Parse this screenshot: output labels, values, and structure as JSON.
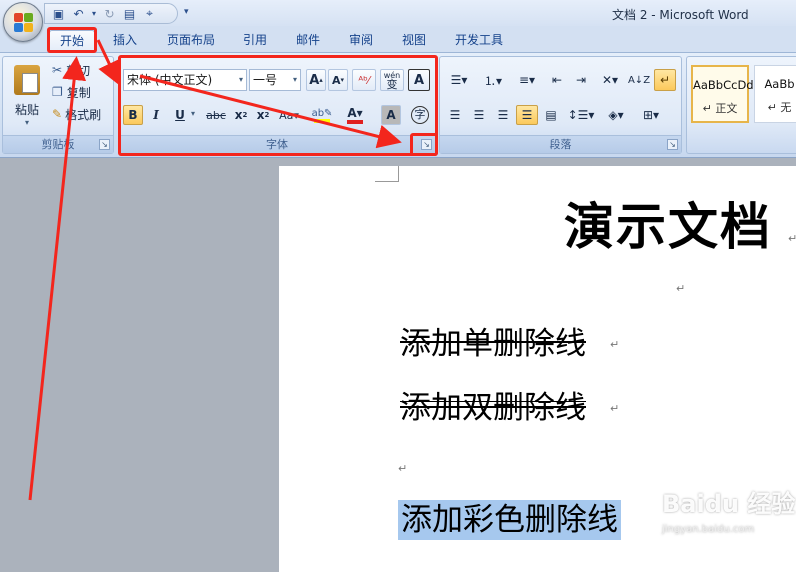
{
  "window": {
    "title": "文档 2 - Microsoft Word"
  },
  "quick_access": [
    "save-icon",
    "undo-icon",
    "redo-icon",
    "print-preview-icon",
    "customize-icon"
  ],
  "tabs": [
    {
      "label": "开始",
      "active": true
    },
    {
      "label": "插入"
    },
    {
      "label": "页面布局"
    },
    {
      "label": "引用"
    },
    {
      "label": "邮件"
    },
    {
      "label": "审阅"
    },
    {
      "label": "视图"
    },
    {
      "label": "开发工具"
    }
  ],
  "clipboard": {
    "paste_label": "粘贴",
    "cut_label": "剪切",
    "copy_label": "复制",
    "format_painter_label": "格式刷",
    "group_label": "剪贴板"
  },
  "font": {
    "font_name": "宋体 (中文正文)",
    "font_size": "一号",
    "grow_label": "A",
    "shrink_label": "A",
    "phonetic_label": "wén",
    "phonetic_char": "变",
    "border_label": "A",
    "bold": "B",
    "italic": "I",
    "underline": "U",
    "strikethrough": "abc",
    "subscript": "x",
    "superscript": "x",
    "shading_label": "A",
    "enclose_label": "字",
    "group_label": "字体"
  },
  "paragraph": {
    "group_label": "段落"
  },
  "styles": [
    {
      "sample": "AaBbCcDd",
      "name": "↵ 正文",
      "selected": true
    },
    {
      "sample": "AaBb",
      "name": "↵ 无"
    }
  ],
  "document": {
    "title": "演示文档",
    "lines": [
      "添加单删除线",
      "添加双删除线",
      "添加彩色删除线"
    ],
    "para_mark": "↵"
  },
  "watermark": {
    "main": "Baidu 经验",
    "sub": "jingyan.baidu.com"
  },
  "colors": {
    "annotation_red": "#f3261d",
    "highlight_yellow": "#ffff00",
    "font_color_red": "#e02020",
    "selection_blue": "#a6c8ee"
  }
}
